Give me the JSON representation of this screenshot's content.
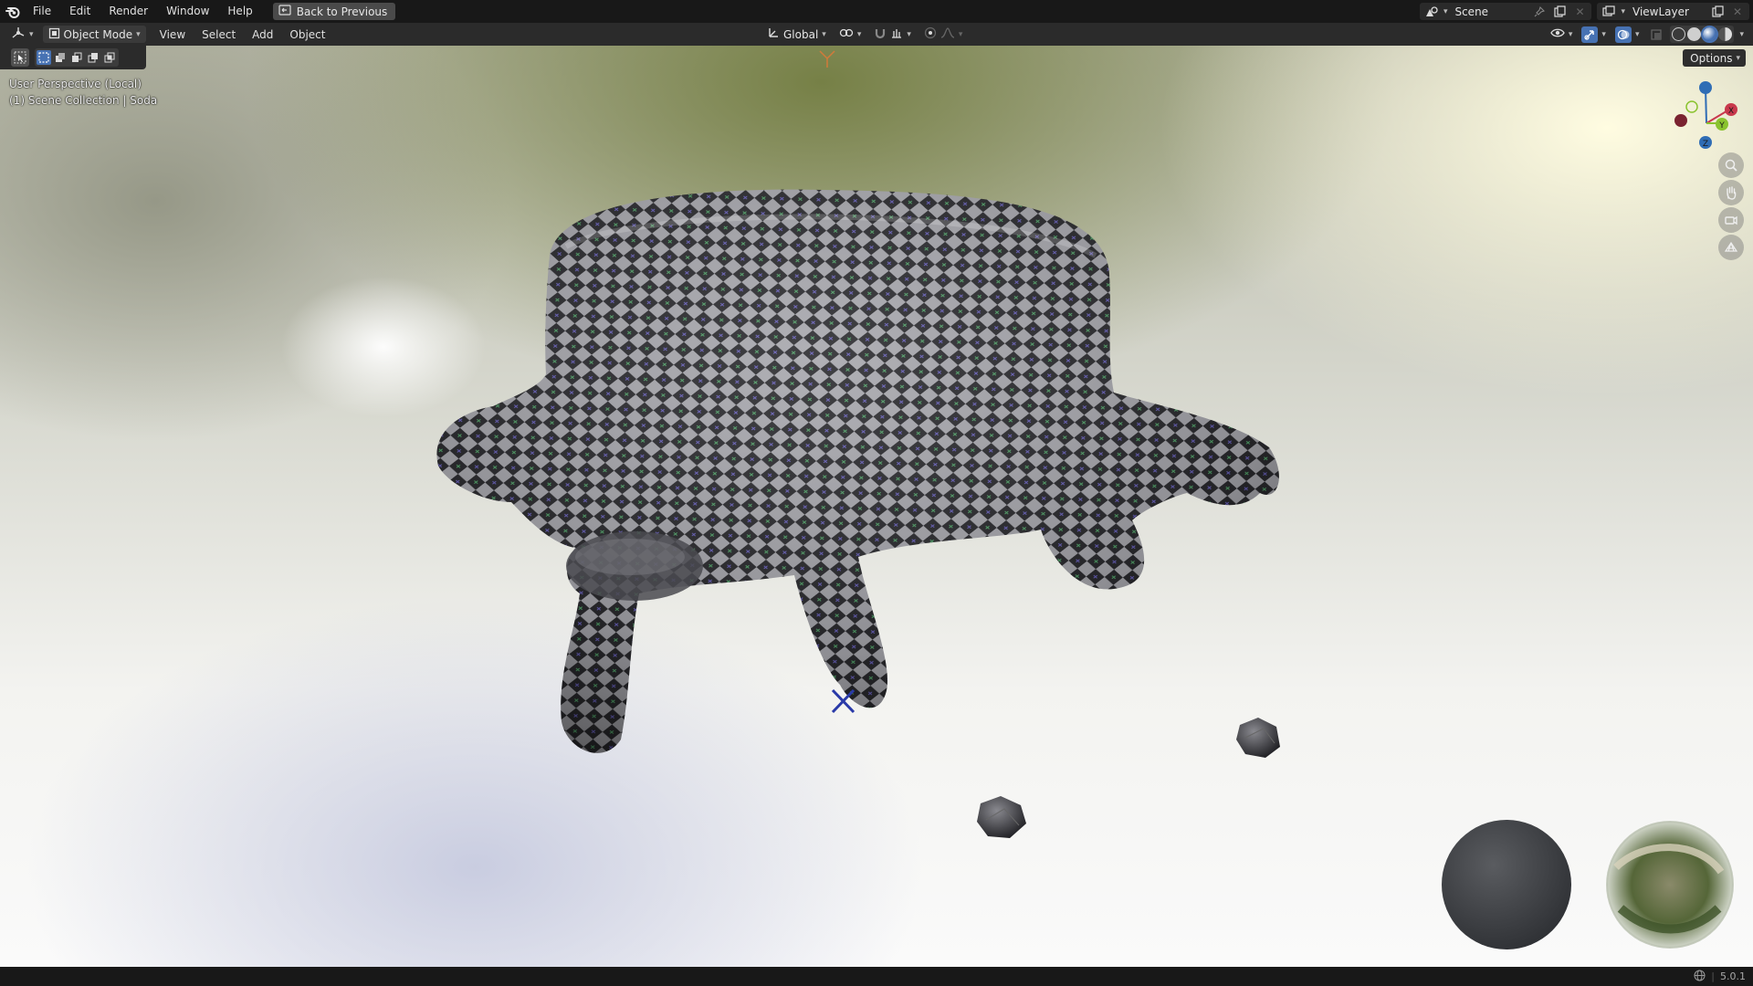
{
  "topbar": {
    "menu": [
      "File",
      "Edit",
      "Render",
      "Window",
      "Help"
    ],
    "back_button": "Back to Previous",
    "scene": "Scene",
    "view_layer": "ViewLayer",
    "icons": [
      "blender-logo-icon",
      "screen-back-icon",
      "scene-selector-icon",
      "pin-icon",
      "duplicate-icon",
      "close-icon",
      "view-layer-icon"
    ]
  },
  "viewport_header": {
    "mode": "Object Mode",
    "menus": [
      "View",
      "Select",
      "Add",
      "Object"
    ],
    "orientation": "Global",
    "options_label": "Options",
    "shading_active": "material-preview",
    "accent_color": "#4772b3"
  },
  "viewport": {
    "perspective_label": "User Perspective (Local)",
    "collection_label": "(1) Scene Collection | Soda",
    "gizmo_axes": [
      "X",
      "Y",
      "Z"
    ],
    "axis_colors": {
      "x": "#c8384c",
      "y": "#8ac32f",
      "z": "#2f6db5"
    },
    "nav_icons": [
      "zoom-icon",
      "pan-hand-icon",
      "camera-view-icon",
      "ortho-grid-icon"
    ]
  },
  "statusbar": {
    "version": "5.0.1"
  }
}
